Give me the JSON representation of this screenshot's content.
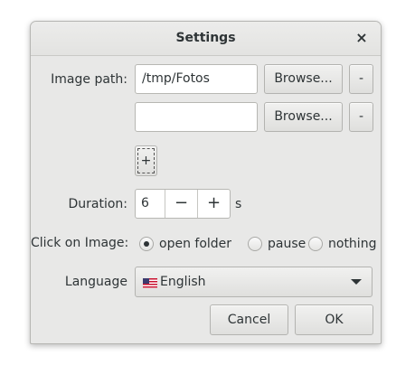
{
  "dialog": {
    "title": "Settings",
    "close_icon": "×"
  },
  "image_path": {
    "label": "Image path:",
    "rows": [
      {
        "value": "/tmp/Fotos",
        "browse_label": "Browse...",
        "remove_label": "-"
      },
      {
        "value": "",
        "browse_label": "Browse...",
        "remove_label": "-"
      }
    ],
    "add_label": "+"
  },
  "duration": {
    "label": "Duration:",
    "value": "6",
    "decrement_label": "−",
    "increment_label": "+",
    "unit": "s"
  },
  "click_on_image": {
    "label": "Click on Image:",
    "options": [
      "open folder",
      "pause",
      "nothing"
    ],
    "selected": "open folder"
  },
  "language": {
    "label": "Language",
    "selected": "English",
    "flag_icon": "us-flag-icon"
  },
  "actions": {
    "cancel_label": "Cancel",
    "ok_label": "OK"
  }
}
